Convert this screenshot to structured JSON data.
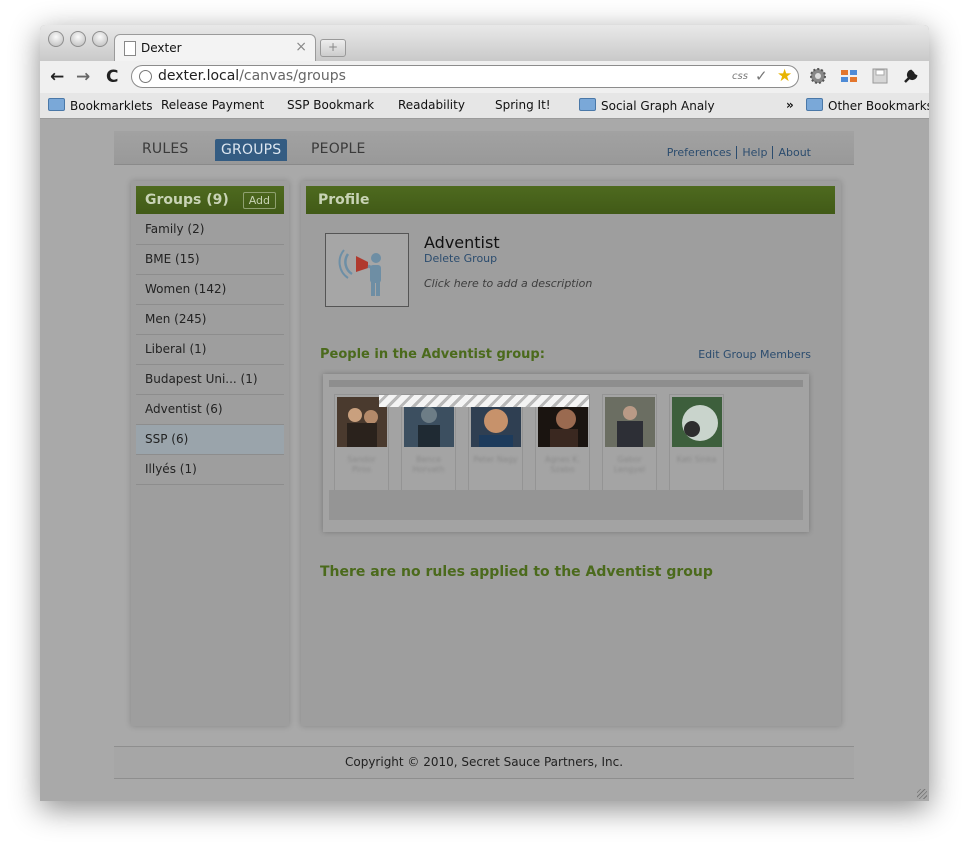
{
  "browser": {
    "tab_title": "Dexter",
    "tab_close": "×",
    "new_tab": "+",
    "back": "←",
    "forward": "→",
    "reload": "C",
    "url_host": "dexter.local",
    "url_path": "/canvas/groups",
    "css_badge": "css",
    "check_glyph": "✓",
    "star_glyph": "★",
    "bookmarks": [
      {
        "label": "Bookmarklets",
        "type": "folder"
      },
      {
        "label": "Release Payment",
        "type": "page"
      },
      {
        "label": "SSP Bookmark",
        "type": "page"
      },
      {
        "label": "Readability",
        "type": "page"
      },
      {
        "label": "Spring It!",
        "type": "page"
      },
      {
        "label": "Social Graph Analytic",
        "type": "folder"
      }
    ],
    "more_chevron": "»",
    "other_bookmarks": "Other Bookmarks"
  },
  "nav": {
    "tabs": [
      "RULES",
      "GROUPS",
      "PEOPLE"
    ],
    "active": "GROUPS",
    "links": [
      "Preferences",
      "Help",
      "About"
    ]
  },
  "sidebar": {
    "title": "Groups (9)",
    "add_label": "Add",
    "groups": [
      "Family (2)",
      "BME (15)",
      "Women (142)",
      "Men (245)",
      "Liberal (1)",
      "Budapest Uni... (1)",
      "Adventist (6)",
      "SSP (6)",
      "Illyés (1)"
    ],
    "selected": "SSP (6)"
  },
  "profile": {
    "header": "Profile",
    "group_name": "Adventist",
    "delete_label": "Delete Group",
    "description_placeholder": "Click here to add a description",
    "people_title": "People in the Adventist group:",
    "edit_members": "Edit Group Members",
    "no_rules": "There are no rules applied to the Adventist group",
    "people_names": [
      "Sandor Piros",
      "Bence Horvath",
      "Peter Nagy",
      "Agnes K. Szabo",
      "Gabor Lengyel",
      "Kati Sinka"
    ]
  },
  "footer": {
    "copyright": "Copyright © 2010, Secret Sauce Partners, Inc."
  },
  "colors": {
    "accent_green": "#4b6a1c",
    "active_tab": "#345c82",
    "link_blue": "#2b4c6e"
  }
}
